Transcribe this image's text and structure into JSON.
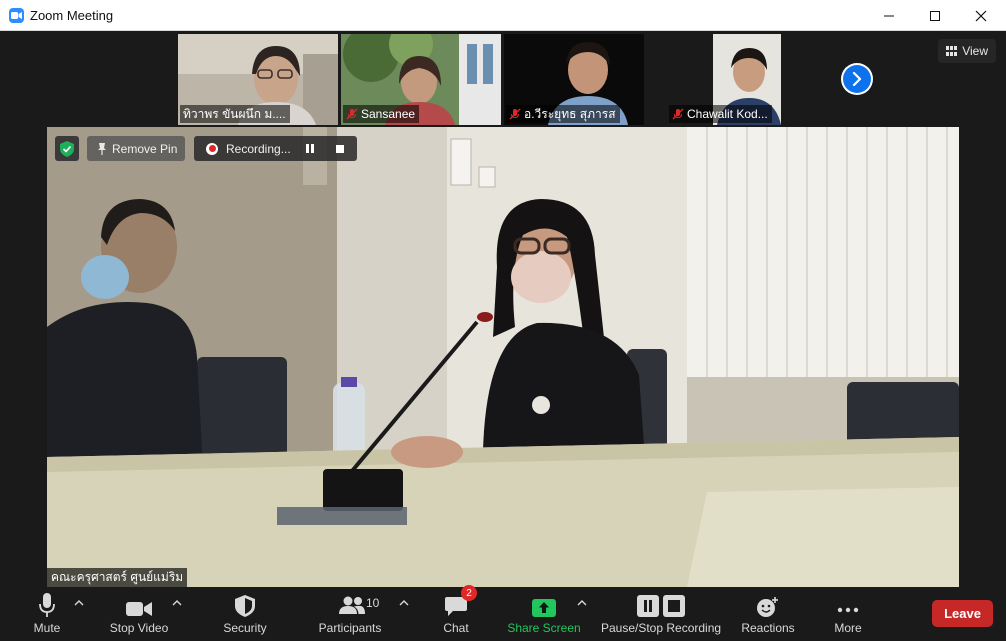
{
  "window": {
    "title": "Zoom Meeting",
    "controls": [
      "minimize",
      "maximize",
      "close"
    ]
  },
  "thumbnails": [
    {
      "name": "ทิวาพร  ขันผนึก ม....",
      "muted": false
    },
    {
      "name": "Sansanee",
      "muted": true
    },
    {
      "name": "อ.วีระยุทธ สุภารส",
      "muted": true
    },
    {
      "name": "Chawalit Kod...",
      "muted": true
    }
  ],
  "view_button": {
    "label": "View"
  },
  "main_video": {
    "participant_name": "คณะครุศาสตร์ ศูนย์แม่ริม",
    "remove_pin_label": "Remove Pin",
    "recording_label": "Recording..."
  },
  "toolbar": {
    "mute_label": "Mute",
    "stop_video_label": "Stop Video",
    "security_label": "Security",
    "participants_label": "Participants",
    "participants_count": "10",
    "chat_label": "Chat",
    "chat_badge": "2",
    "share_screen_label": "Share Screen",
    "recording_label": "Pause/Stop Recording",
    "reactions_label": "Reactions",
    "more_label": "More",
    "leave_label": "Leave"
  },
  "colors": {
    "accent_blue": "#2d8cff",
    "share_green": "#22c55e",
    "leave_red": "#c62828",
    "badge_red": "#e02828"
  }
}
